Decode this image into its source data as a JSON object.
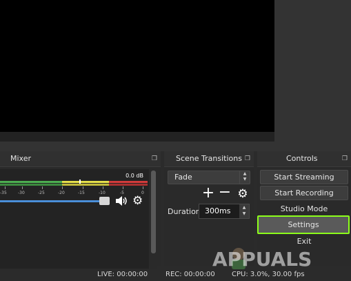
{
  "mixer": {
    "title": "Mixer",
    "db_readout": "0.0 dB",
    "ticks": [
      "-35",
      "-30",
      "-25",
      "-20",
      "-15",
      "-10",
      "-5",
      "0"
    ],
    "volume_fraction": 0.92
  },
  "transitions": {
    "title": "Scene Transitions",
    "selected": "Fade",
    "duration_label": "Duration",
    "duration_value": "300ms"
  },
  "controls": {
    "title": "Controls",
    "buttons": [
      "Start Streaming",
      "Start Recording",
      "Studio Mode",
      "Settings",
      "Exit"
    ]
  },
  "statusbar": {
    "live": "LIVE: 00:00:00",
    "rec": "REC: 00:00:00",
    "cpu": "CPU: 3.0%, 30.00 fps"
  },
  "watermark": {
    "text": "APPUALS"
  },
  "colors": {
    "accent": "#4a8fd9",
    "highlight": "#8cff1a",
    "meter_green": "#4caf50",
    "meter_yellow": "#e6e04a",
    "meter_red": "#d43b3b"
  }
}
